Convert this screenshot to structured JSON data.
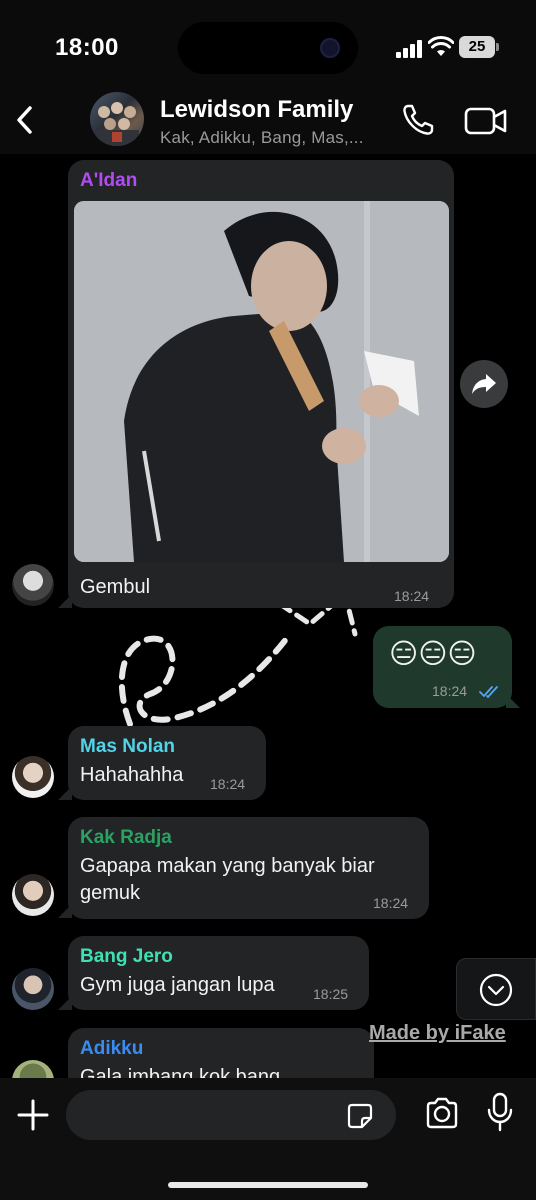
{
  "status_bar": {
    "time": "18:00",
    "battery": "25"
  },
  "header": {
    "title": "Lewidson Family",
    "subtitle": "Kak, Adikku, Bang, Mas,..."
  },
  "messages": [
    {
      "sender": "A'Idan",
      "sender_color": "#b04cf2",
      "text": "Gembul",
      "time": "18:24",
      "has_photo": true
    },
    {
      "outgoing": true,
      "text": "😑😑😑",
      "time": "18:24",
      "read": true
    },
    {
      "sender": "Mas Nolan",
      "sender_color": "#52d3e8",
      "text": "Hahahahha",
      "time": "18:24"
    },
    {
      "sender": "Kak Radja",
      "sender_color": "#2aa264",
      "text": "Gapapa makan yang banyak biar gemuk",
      "line1": "Gapapa makan yang banyak biar",
      "line2": "gemuk",
      "time": "18:24"
    },
    {
      "sender": "Bang Jero",
      "sender_color": "#3fe0b4",
      "text": "Gym juga jangan lupa",
      "time": "18:25"
    },
    {
      "sender": "Adikku",
      "sender_color": "#3b8cf0",
      "text": "Gala imbang kok bang"
    }
  ],
  "watermark": "Made by iFake",
  "composer": {
    "placeholder": ""
  },
  "icons": {
    "back": "chevron-left-icon",
    "call": "phone-icon",
    "video": "video-camera-icon",
    "forward": "forward-arrow-icon",
    "scroll": "chevron-down-circle-icon",
    "plus": "plus-icon",
    "sticker": "sticker-icon",
    "camera": "camera-icon",
    "mic": "microphone-icon",
    "read_receipt": "double-check-icon"
  },
  "colors": {
    "incoming_bubble": "#232426",
    "outgoing_bubble": "#1f3a2c",
    "read_check": "#53a6f5"
  }
}
